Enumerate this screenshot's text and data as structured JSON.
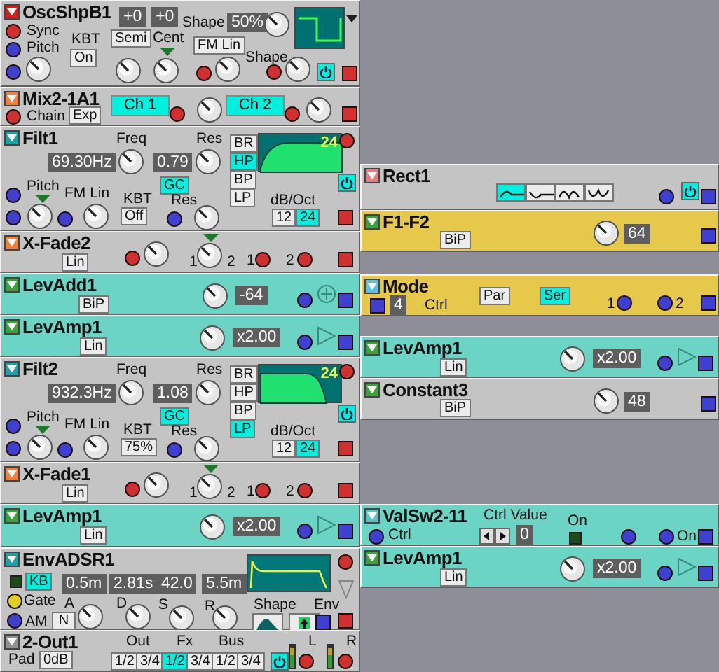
{
  "modules": [
    {
      "kind": "osc",
      "title": "OscShpB1",
      "color": "#c4c4c4",
      "icon": {
        "color": "#d02020"
      },
      "controls": [
        {
          "kind": "in",
          "color": "#d03030"
        },
        {
          "kind": "label",
          "text": "Sync"
        },
        {
          "kind": "in",
          "color": "#4040d0"
        },
        {
          "kind": "label",
          "text": "Pitch"
        },
        {
          "kind": "in",
          "color": "#4040d0"
        },
        {
          "kind": "knob"
        },
        {
          "kind": "label",
          "text": "KBT"
        },
        {
          "kind": "toggle",
          "text": "On",
          "selected": false
        },
        {
          "kind": "display",
          "text": "+0"
        },
        {
          "kind": "display",
          "text": "+0"
        },
        {
          "kind": "toggle",
          "text": "Semi",
          "selected": false
        },
        {
          "kind": "label",
          "text": "Cent"
        },
        {
          "kind": "marker"
        },
        {
          "kind": "knob"
        },
        {
          "kind": "knob"
        },
        {
          "kind": "toggle",
          "text": "FM Lin",
          "selected": false
        },
        {
          "kind": "label",
          "text": "Shape"
        },
        {
          "kind": "display",
          "text": "50%"
        },
        {
          "kind": "knob"
        },
        {
          "kind": "wave-graph"
        },
        {
          "kind": "dropdown"
        },
        {
          "kind": "in",
          "color": "#d03030"
        },
        {
          "kind": "knob"
        },
        {
          "kind": "label",
          "text": "Shape"
        },
        {
          "kind": "in",
          "color": "#d03030"
        },
        {
          "kind": "knob"
        },
        {
          "kind": "power",
          "on": true
        },
        {
          "kind": "out",
          "color": "#d03030"
        }
      ]
    },
    {
      "kind": "mix",
      "title": "Mix2-1A1",
      "color": "#c4c4c4",
      "icon": {
        "color": "#f08040"
      },
      "controls": [
        {
          "kind": "in",
          "color": "#d03030"
        },
        {
          "kind": "label",
          "text": "Chain"
        },
        {
          "kind": "toggle",
          "text": "Exp",
          "selected": false
        },
        {
          "kind": "tag",
          "text": "Ch 1"
        },
        {
          "kind": "in",
          "color": "#d03030"
        },
        {
          "kind": "knob"
        },
        {
          "kind": "tag",
          "text": "Ch 2"
        },
        {
          "kind": "in",
          "color": "#d03030"
        },
        {
          "kind": "knob"
        },
        {
          "kind": "out",
          "color": "#d03030"
        }
      ]
    },
    {
      "kind": "filter",
      "title": "Filt1",
      "color": "#c4c4c4",
      "icon": {
        "color": "#20a0a0"
      },
      "controls": [
        {
          "kind": "label",
          "text": "Freq"
        },
        {
          "kind": "display",
          "text": "69.30Hz"
        },
        {
          "kind": "knob"
        },
        {
          "kind": "label",
          "text": "Res"
        },
        {
          "kind": "display",
          "text": "0.79"
        },
        {
          "kind": "knob"
        },
        {
          "kind": "toggle",
          "text": "GC",
          "selected": true
        },
        {
          "kind": "toggle",
          "text": "BR",
          "selected": false
        },
        {
          "kind": "toggle",
          "text": "HP",
          "selected": true
        },
        {
          "kind": "toggle",
          "text": "BP",
          "selected": false
        },
        {
          "kind": "toggle",
          "text": "LP",
          "selected": false
        },
        {
          "kind": "filter-graph",
          "text": "24"
        },
        {
          "kind": "in",
          "color": "#d03030"
        },
        {
          "kind": "power",
          "on": true
        },
        {
          "kind": "out",
          "color": "#d03030"
        },
        {
          "kind": "in",
          "color": "#4040d0"
        },
        {
          "kind": "label",
          "text": "Pitch"
        },
        {
          "kind": "marker"
        },
        {
          "kind": "knob"
        },
        {
          "kind": "label",
          "text": "FM Lin"
        },
        {
          "kind": "in",
          "color": "#4040d0"
        },
        {
          "kind": "knob"
        },
        {
          "kind": "label",
          "text": "KBT"
        },
        {
          "kind": "toggle",
          "text": "Off",
          "selected": false
        },
        {
          "kind": "label",
          "text": "Res"
        },
        {
          "kind": "in",
          "color": "#4040d0"
        },
        {
          "kind": "knob"
        },
        {
          "kind": "label",
          "text": "dB/Oct"
        },
        {
          "kind": "toggle",
          "text": "12",
          "selected": false
        },
        {
          "kind": "toggle",
          "text": "24",
          "selected": true
        },
        {
          "kind": "in",
          "color": "#4040d0"
        }
      ]
    },
    {
      "kind": "xfade",
      "title": "X-Fade2",
      "color": "#c4c4c4",
      "icon": {
        "color": "#f08040"
      },
      "controls": [
        {
          "kind": "toggle",
          "text": "Lin",
          "selected": false
        },
        {
          "kind": "in",
          "color": "#d03030"
        },
        {
          "kind": "knob"
        },
        {
          "kind": "marker"
        },
        {
          "kind": "label",
          "text": "1"
        },
        {
          "kind": "knob"
        },
        {
          "kind": "label",
          "text": "2"
        },
        {
          "kind": "label",
          "text": "1"
        },
        {
          "kind": "in",
          "color": "#d03030"
        },
        {
          "kind": "label",
          "text": "2"
        },
        {
          "kind": "in",
          "color": "#d03030"
        },
        {
          "kind": "out",
          "color": "#d03030"
        }
      ]
    },
    {
      "kind": "levadd",
      "title": "LevAdd1",
      "color": "#6cd4c4",
      "icon": {
        "color": "#40a040"
      },
      "controls": [
        {
          "kind": "toggle",
          "text": "BiP",
          "selected": false
        },
        {
          "kind": "knob"
        },
        {
          "kind": "display",
          "text": "-64"
        },
        {
          "kind": "in",
          "color": "#4040d0"
        },
        {
          "kind": "adder"
        },
        {
          "kind": "out",
          "color": "#4040d0"
        }
      ]
    },
    {
      "kind": "levamp",
      "title": "LevAmp1",
      "color": "#6cd4c4",
      "icon": {
        "color": "#40a040"
      },
      "controls": [
        {
          "kind": "toggle",
          "text": "Lin",
          "selected": false
        },
        {
          "kind": "knob"
        },
        {
          "kind": "display",
          "text": "x2.00"
        },
        {
          "kind": "in",
          "color": "#4040d0"
        },
        {
          "kind": "amp"
        },
        {
          "kind": "out",
          "color": "#4040d0"
        }
      ]
    },
    {
      "kind": "filter",
      "title": "Filt2",
      "color": "#c4c4c4",
      "icon": {
        "color": "#20a0a0"
      },
      "controls": [
        {
          "kind": "label",
          "text": "Freq"
        },
        {
          "kind": "display",
          "text": "932.3Hz"
        },
        {
          "kind": "knob"
        },
        {
          "kind": "label",
          "text": "Res"
        },
        {
          "kind": "display",
          "text": "1.08"
        },
        {
          "kind": "knob"
        },
        {
          "kind": "toggle",
          "text": "GC",
          "selected": true
        },
        {
          "kind": "toggle",
          "text": "BR",
          "selected": false
        },
        {
          "kind": "toggle",
          "text": "HP",
          "selected": false
        },
        {
          "kind": "toggle",
          "text": "BP",
          "selected": false
        },
        {
          "kind": "toggle",
          "text": "LP",
          "selected": true
        },
        {
          "kind": "filter-graph",
          "text": "24"
        },
        {
          "kind": "in",
          "color": "#d03030"
        },
        {
          "kind": "power",
          "on": true
        },
        {
          "kind": "out",
          "color": "#d03030"
        },
        {
          "kind": "in",
          "color": "#4040d0"
        },
        {
          "kind": "label",
          "text": "Pitch"
        },
        {
          "kind": "marker"
        },
        {
          "kind": "knob"
        },
        {
          "kind": "label",
          "text": "FM Lin"
        },
        {
          "kind": "in",
          "color": "#4040d0"
        },
        {
          "kind": "knob"
        },
        {
          "kind": "label",
          "text": "KBT"
        },
        {
          "kind": "toggle",
          "text": "75%",
          "selected": false
        },
        {
          "kind": "label",
          "text": "Res"
        },
        {
          "kind": "in",
          "color": "#4040d0"
        },
        {
          "kind": "knob"
        },
        {
          "kind": "label",
          "text": "dB/Oct"
        },
        {
          "kind": "toggle",
          "text": "12",
          "selected": false
        },
        {
          "kind": "toggle",
          "text": "24",
          "selected": true
        },
        {
          "kind": "in",
          "color": "#4040d0"
        }
      ]
    },
    {
      "kind": "xfade",
      "title": "X-Fade1",
      "color": "#c4c4c4",
      "icon": {
        "color": "#f08040"
      },
      "controls": [
        {
          "kind": "toggle",
          "text": "Lin",
          "selected": false
        },
        {
          "kind": "in",
          "color": "#d03030"
        },
        {
          "kind": "knob"
        },
        {
          "kind": "marker"
        },
        {
          "kind": "label",
          "text": "1"
        },
        {
          "kind": "knob"
        },
        {
          "kind": "label",
          "text": "2"
        },
        {
          "kind": "label",
          "text": "1"
        },
        {
          "kind": "in",
          "color": "#d03030"
        },
        {
          "kind": "label",
          "text": "2"
        },
        {
          "kind": "in",
          "color": "#d03030"
        },
        {
          "kind": "out",
          "color": "#d03030"
        }
      ]
    },
    {
      "kind": "levamp",
      "title": "LevAmp1",
      "color": "#6cd4c4",
      "icon": {
        "color": "#40a040"
      },
      "controls": [
        {
          "kind": "toggle",
          "text": "Lin",
          "selected": false
        },
        {
          "kind": "knob"
        },
        {
          "kind": "display",
          "text": "x2.00"
        },
        {
          "kind": "in",
          "color": "#4040d0"
        },
        {
          "kind": "amp"
        },
        {
          "kind": "out",
          "color": "#4040d0"
        }
      ]
    },
    {
      "kind": "env",
      "title": "EnvADSR1",
      "color": "#c4c4c4",
      "icon": {
        "color": "#20a0a0"
      },
      "controls": [
        {
          "kind": "led",
          "on": false
        },
        {
          "kind": "toggle",
          "text": "KB",
          "selected": true
        },
        {
          "kind": "display",
          "text": "0.5m"
        },
        {
          "kind": "display",
          "text": "2.81s"
        },
        {
          "kind": "display",
          "text": "42.0"
        },
        {
          "kind": "display",
          "text": "5.5m"
        },
        {
          "kind": "env-graph"
        },
        {
          "kind": "in",
          "color": "#e0d020"
        },
        {
          "kind": "label",
          "text": "Gate"
        },
        {
          "kind": "label",
          "text": "A"
        },
        {
          "kind": "in",
          "color": "#4040d0"
        },
        {
          "kind": "label",
          "text": "AM"
        },
        {
          "kind": "toggle",
          "text": "N",
          "selected": false
        },
        {
          "kind": "knob"
        },
        {
          "kind": "label",
          "text": "D"
        },
        {
          "kind": "knob"
        },
        {
          "kind": "label",
          "text": "S"
        },
        {
          "kind": "knob"
        },
        {
          "kind": "label",
          "text": "R"
        },
        {
          "kind": "knob"
        },
        {
          "kind": "label",
          "text": "Shape"
        },
        {
          "kind": "shape-button"
        },
        {
          "kind": "arrow-button"
        },
        {
          "kind": "label",
          "text": "Env"
        },
        {
          "kind": "out",
          "color": "#4040d0"
        },
        {
          "kind": "in",
          "color": "#d03030"
        },
        {
          "kind": "signal-arrow"
        },
        {
          "kind": "out",
          "color": "#d03030"
        }
      ]
    },
    {
      "kind": "out2",
      "title": "2-Out1",
      "color": "#c4c4c4",
      "icon": {
        "color": "#909090"
      },
      "controls": [
        {
          "kind": "label",
          "text": "Out"
        },
        {
          "kind": "label",
          "text": "Fx"
        },
        {
          "kind": "label",
          "text": "Bus"
        },
        {
          "kind": "label",
          "text": "L"
        },
        {
          "kind": "label",
          "text": "R"
        },
        {
          "kind": "label",
          "text": "Pad"
        },
        {
          "kind": "toggle",
          "text": "0dB",
          "selected": false
        },
        {
          "kind": "toggle",
          "text": "1/2",
          "selected": false
        },
        {
          "kind": "toggle",
          "text": "3/4",
          "selected": false
        },
        {
          "kind": "toggle",
          "text": "1/2",
          "selected": true
        },
        {
          "kind": "toggle",
          "text": "3/4",
          "selected": false
        },
        {
          "kind": "toggle",
          "text": "1/2",
          "selected": false
        },
        {
          "kind": "toggle",
          "text": "3/4",
          "selected": false
        },
        {
          "kind": "power",
          "on": true
        },
        {
          "kind": "meter"
        },
        {
          "kind": "in",
          "color": "#d03030"
        },
        {
          "kind": "meter"
        },
        {
          "kind": "in",
          "color": "#d03030"
        }
      ]
    },
    {
      "kind": "rect",
      "title": "Rect1",
      "color": "#c4c4c4",
      "icon": {
        "color": "#e08080"
      },
      "controls": [
        {
          "kind": "wave-button",
          "selected": true
        },
        {
          "kind": "wave-button",
          "selected": false
        },
        {
          "kind": "wave-button",
          "selected": false
        },
        {
          "kind": "wave-button",
          "selected": false
        },
        {
          "kind": "in",
          "color": "#4040d0"
        },
        {
          "kind": "power",
          "on": true
        },
        {
          "kind": "out",
          "color": "#4040d0"
        }
      ]
    },
    {
      "kind": "constant",
      "title": "F1-F2",
      "color": "#e6c84a",
      "icon": {
        "color": "#40a040"
      },
      "controls": [
        {
          "kind": "toggle",
          "text": "BiP",
          "selected": false
        },
        {
          "kind": "knob"
        },
        {
          "kind": "display",
          "text": "64"
        },
        {
          "kind": "out",
          "color": "#4040d0"
        }
      ]
    },
    {
      "kind": "mode",
      "title": "Mode",
      "color": "#e6c84a",
      "icon": {
        "color": "#60c0e0"
      },
      "controls": [
        {
          "kind": "out",
          "color": "#4040d0"
        },
        {
          "kind": "display",
          "text": "4"
        },
        {
          "kind": "label",
          "text": "Ctrl"
        },
        {
          "kind": "toggle",
          "text": "Par",
          "selected": false
        },
        {
          "kind": "toggle",
          "text": "Ser",
          "selected": true
        },
        {
          "kind": "label",
          "text": "1"
        },
        {
          "kind": "in",
          "color": "#4040d0"
        },
        {
          "kind": "in",
          "color": "#4040d0"
        },
        {
          "kind": "label",
          "text": "2"
        },
        {
          "kind": "out",
          "color": "#4040d0"
        }
      ]
    },
    {
      "kind": "levamp",
      "title": "LevAmp1",
      "color": "#6cd4c4",
      "icon": {
        "color": "#40a040"
      },
      "controls": [
        {
          "kind": "toggle",
          "text": "Lin",
          "selected": false
        },
        {
          "kind": "knob"
        },
        {
          "kind": "display",
          "text": "x2.00"
        },
        {
          "kind": "in",
          "color": "#4040d0"
        },
        {
          "kind": "amp"
        },
        {
          "kind": "out",
          "color": "#4040d0"
        }
      ]
    },
    {
      "kind": "constant",
      "title": "Constant3",
      "color": "#c4c4c4",
      "icon": {
        "color": "#40a040"
      },
      "controls": [
        {
          "kind": "toggle",
          "text": "BiP",
          "selected": false
        },
        {
          "kind": "knob"
        },
        {
          "kind": "display",
          "text": "48"
        },
        {
          "kind": "out",
          "color": "#4040d0"
        }
      ]
    },
    {
      "kind": "valsw",
      "title": "ValSw2-11",
      "color": "#6cd4c4",
      "icon": {
        "color": "#60c0c0"
      },
      "controls": [
        {
          "kind": "in",
          "color": "#4040d0"
        },
        {
          "kind": "label",
          "text": "Ctrl"
        },
        {
          "kind": "label",
          "text": "Ctrl Value"
        },
        {
          "kind": "stepper"
        },
        {
          "kind": "display",
          "text": "0"
        },
        {
          "kind": "label",
          "text": "On"
        },
        {
          "kind": "led",
          "on": false
        },
        {
          "kind": "in",
          "color": "#4040d0"
        },
        {
          "kind": "in",
          "color": "#4040d0"
        },
        {
          "kind": "label",
          "text": "On"
        },
        {
          "kind": "out",
          "color": "#4040d0"
        }
      ]
    },
    {
      "kind": "levamp",
      "title": "LevAmp1",
      "color": "#6cd4c4",
      "icon": {
        "color": "#40a040"
      },
      "controls": [
        {
          "kind": "toggle",
          "text": "Lin",
          "selected": false
        },
        {
          "kind": "knob"
        },
        {
          "kind": "display",
          "text": "x2.00"
        },
        {
          "kind": "in",
          "color": "#4040d0"
        },
        {
          "kind": "amp"
        },
        {
          "kind": "out",
          "color": "#4040d0"
        }
      ]
    }
  ]
}
